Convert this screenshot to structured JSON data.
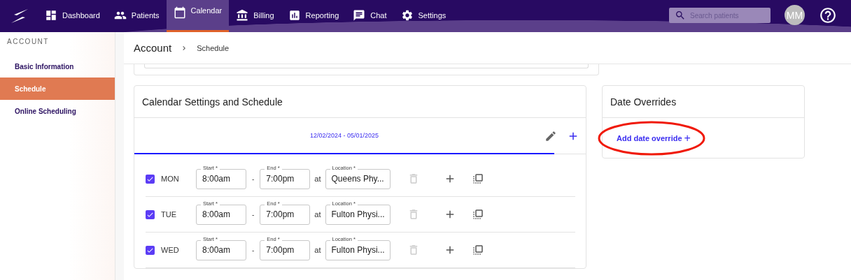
{
  "nav": {
    "items": [
      {
        "label": "Dashboard",
        "kind": "dashboard",
        "selected": false
      },
      {
        "label": "Patients",
        "kind": "patients",
        "selected": false
      },
      {
        "label": "Calendar",
        "kind": "calendar",
        "selected": true
      },
      {
        "label": "Billing",
        "kind": "billing",
        "selected": false
      },
      {
        "label": "Reporting",
        "kind": "reporting",
        "selected": false
      },
      {
        "label": "Chat",
        "kind": "chat",
        "selected": false
      },
      {
        "label": "Settings",
        "kind": "settings",
        "selected": false
      }
    ],
    "search": {
      "placeholder": "Search patients"
    },
    "avatar": "MM"
  },
  "sidebar": {
    "heading": "ACCOUNT",
    "items": [
      {
        "label": "Basic Information",
        "selected": false
      },
      {
        "label": "Schedule",
        "selected": true
      },
      {
        "label": "Online Scheduling",
        "selected": false
      }
    ]
  },
  "breadcrumb": {
    "title": "Account",
    "current": "Schedule"
  },
  "schedule_card": {
    "title": "Calendar Settings and Schedule",
    "range_tab": {
      "label": "12/02/2024 - 05/01/2025",
      "selected": true
    },
    "rows": [
      {
        "day": "MON",
        "checked": true,
        "start_label": "Start *",
        "start": "8:00am",
        "separator": "-",
        "end_label": "End *",
        "end": "7:00pm",
        "at": "at",
        "location_label": "Location *",
        "location": "Queens Phy..."
      },
      {
        "day": "TUE",
        "checked": true,
        "start_label": "Start *",
        "start": "8:00am",
        "separator": "-",
        "end_label": "End *",
        "end": "7:00pm",
        "at": "at",
        "location_label": "Location *",
        "location": "Fulton Physi..."
      },
      {
        "day": "WED",
        "checked": true,
        "start_label": "Start *",
        "start": "8:00am",
        "separator": "-",
        "end_label": "End *",
        "end": "7:00pm",
        "at": "at",
        "location_label": "Location *",
        "location": "Fulton Physi..."
      }
    ]
  },
  "overrides_card": {
    "title": "Date Overrides",
    "link": "Add date override",
    "link_icon": "+",
    "annotated": true
  }
}
